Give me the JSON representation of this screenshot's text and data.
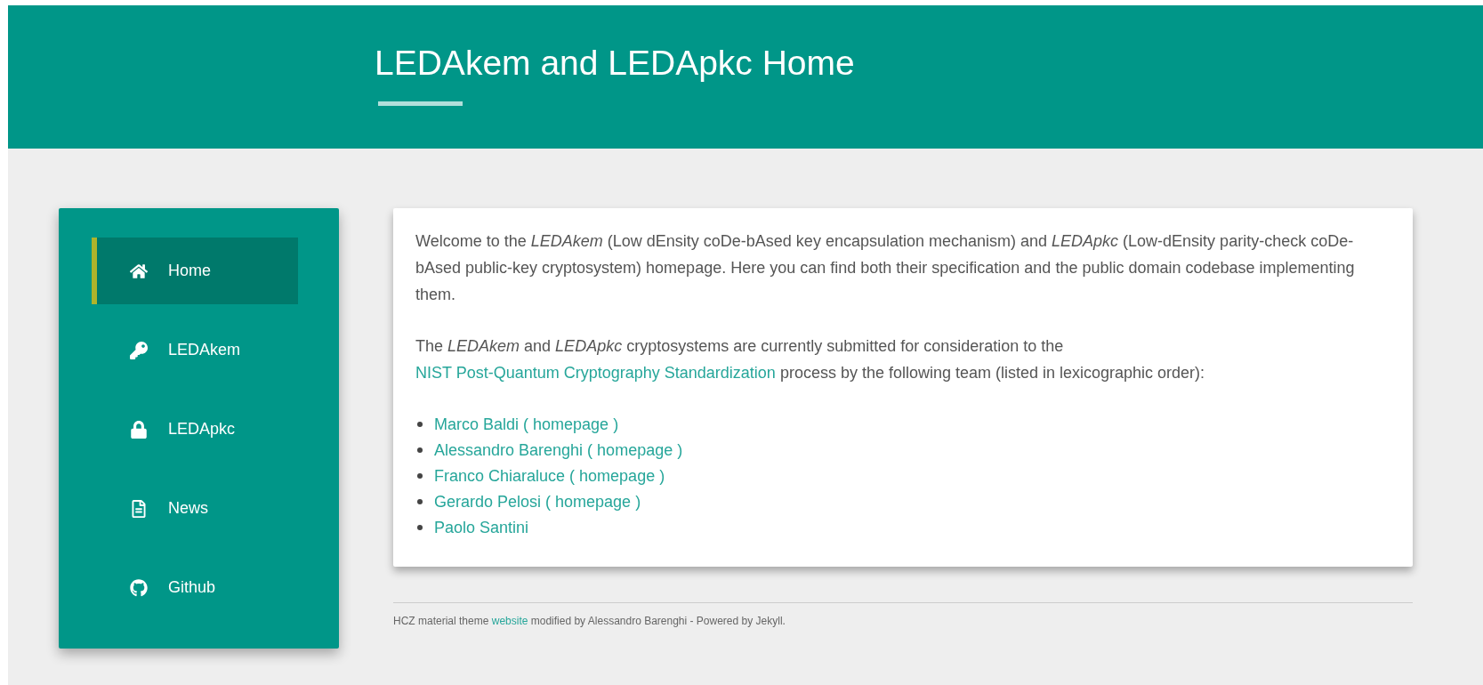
{
  "header": {
    "title": "LEDAkem and LEDApkc Home"
  },
  "sidebar": {
    "items": [
      {
        "label": "Home",
        "selected": true
      },
      {
        "label": "LEDAkem",
        "selected": false
      },
      {
        "label": "LEDApkc",
        "selected": false
      },
      {
        "label": "News",
        "selected": false
      },
      {
        "label": "Github",
        "selected": false
      }
    ]
  },
  "content": {
    "intro": "Welcome to the *LEDAkem* (Low dEnsity coDe-bAsed key encapsulation mechanism) and *LEDApkc* (Low-dEnsity parity-check coDe-bAsed public-key cryptosystem) homepage. Here you can find both their specification and the public domain codebase implementing them.",
    "submission": {
      "before": "The *LEDAkem* and *LEDApkc* cryptosystems are currently submitted for consideration to the",
      "link": "NIST Post-Quantum Cryptography Standardization",
      "after": "process by the following team (listed in lexicographic order):"
    },
    "team": [
      {
        "name": "Marco Baldi",
        "open": "(",
        "homepage": "homepage",
        "close": ")"
      },
      {
        "name": "Alessandro Barenghi",
        "open": "(",
        "homepage": "homepage",
        "close": ")"
      },
      {
        "name": "Franco Chiaraluce",
        "open": "(",
        "homepage": "homepage",
        "close": ")"
      },
      {
        "name": "Gerardo Pelosi",
        "open": "(",
        "homepage": "homepage",
        "close": ")"
      },
      {
        "name": "Paolo Santini"
      }
    ]
  },
  "footer": {
    "before": "HCZ material theme",
    "link": "website",
    "after": "modified by Alessandro Barenghi - Powered by Jekyll."
  }
}
